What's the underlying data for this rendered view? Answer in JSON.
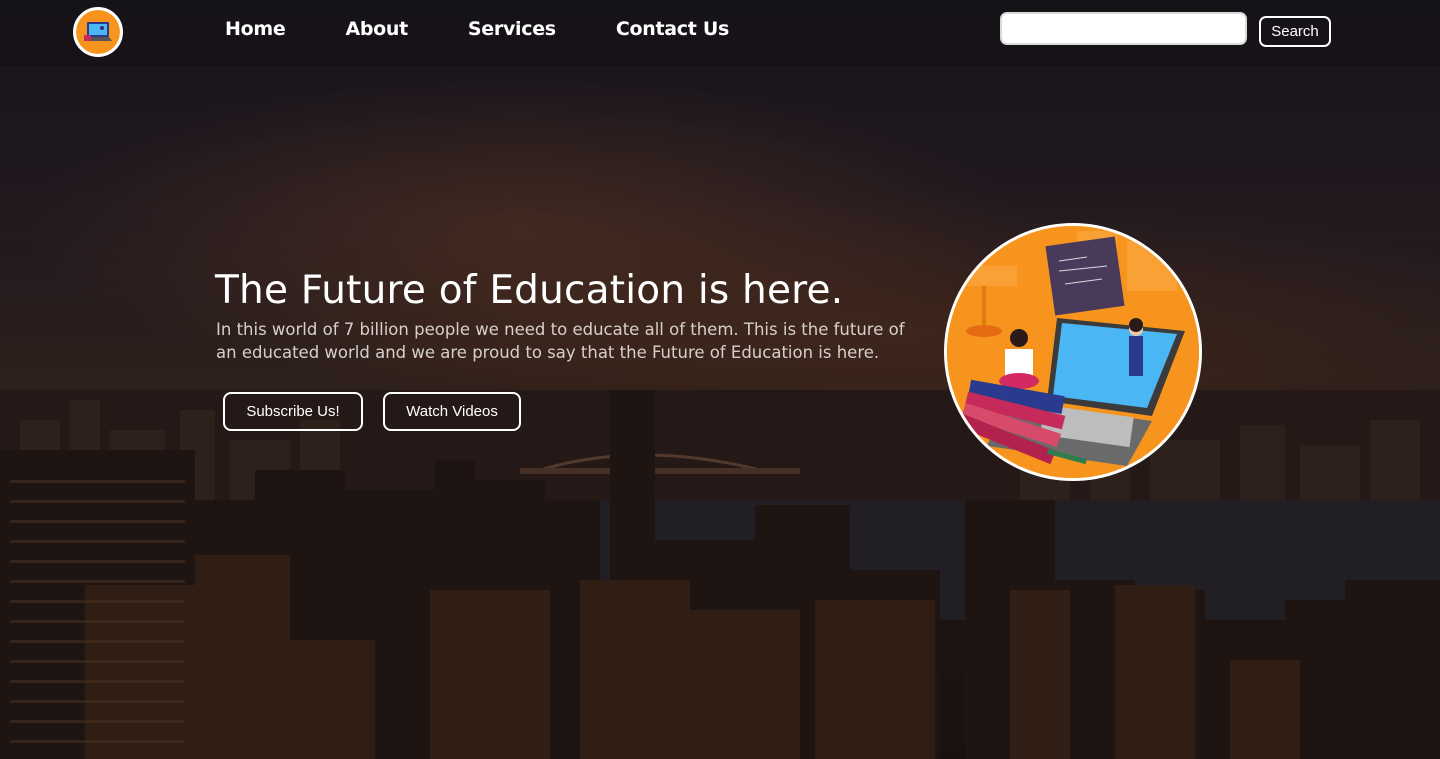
{
  "header": {
    "logo_icon": "online-learning-logo-icon",
    "nav": [
      {
        "label": "Home"
      },
      {
        "label": "About"
      },
      {
        "label": "Services"
      },
      {
        "label": "Contact Us"
      }
    ],
    "search": {
      "value": "",
      "placeholder": "",
      "button_label": "Search"
    }
  },
  "hero": {
    "title": "The Future of Education is here.",
    "text": "In this world of 7 billion people we need to educate all of them. This is the future of an educated world and we are proud to say that the Future of Education is here.",
    "buttons": {
      "subscribe": "Subscribe Us!",
      "watch": "Watch Videos"
    },
    "image_icon": "online-education-illustration-icon"
  },
  "colors": {
    "accent_orange": "#f7941d",
    "text_white": "#ffffff",
    "body_text": "#d6d0cc"
  }
}
